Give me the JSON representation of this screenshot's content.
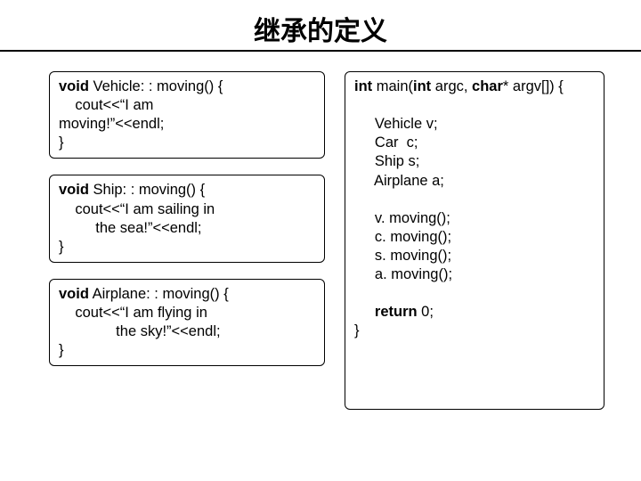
{
  "title": "继承的定义",
  "box1": {
    "l1a": "void",
    "l1b": " Vehicle: : moving() {",
    "l2": "    cout<<“I am",
    "l3": "moving!”<<endl;",
    "l4": "}"
  },
  "box2": {
    "l1a": "void",
    "l1b": " Ship: : moving() {",
    "l2": "    cout<<“I am sailing in",
    "l3": "         the sea!”<<endl;",
    "l4": "}"
  },
  "box3": {
    "l1a": "void",
    "l1b": " Airplane: : moving() {",
    "l2": "    cout<<“I am flying in",
    "l3": "              the sky!”<<endl;",
    "l4": "}"
  },
  "main": {
    "sig1": "int",
    "sig2": " main(",
    "sig3": "int",
    "sig4": " argc, ",
    "sig5": "char",
    "sig6": "* argv[]) {",
    "l2": "",
    "l3": "     Vehicle v;",
    "l4": "     Car  c;",
    "l5": "     Ship s;",
    "l6": "     Airplane a;",
    "l7": "",
    "l8": "     v. moving();",
    "l9": "     c. moving();",
    "l10": "     s. moving();",
    "l11": "     a. moving();",
    "l12": "",
    "l13a": "     ",
    "l13b": "return",
    "l13c": " 0;",
    "l14": "}"
  }
}
